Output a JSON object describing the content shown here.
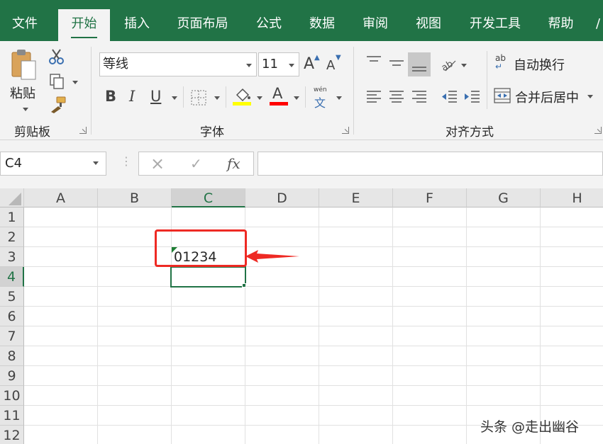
{
  "tabs": [
    "文件",
    "开始",
    "插入",
    "页面布局",
    "公式",
    "数据",
    "审阅",
    "视图",
    "开发工具",
    "帮助"
  ],
  "active_tab_index": 1,
  "clipboard": {
    "paste_label": "粘贴",
    "group_label": "剪贴板"
  },
  "font": {
    "font_name": "等线",
    "font_size": "11",
    "bold": "B",
    "italic": "I",
    "underline": "U",
    "grow_font": "A",
    "shrink_font": "A",
    "font_color_letter": "A",
    "phonetic_top": "wén",
    "phonetic_char": "文",
    "group_label": "字体",
    "highlight_color": "#ffff00",
    "font_color": "#ff0000"
  },
  "alignment": {
    "wrap_text_label": "自动换行",
    "wrap_icon_text": "ab",
    "merge_label": "合并后居中",
    "group_label": "对齐方式"
  },
  "formula_bar": {
    "name_box": "C4",
    "cancel_icon": "×",
    "enter_icon": "✓",
    "fx_label": "fx",
    "formula": ""
  },
  "sheet": {
    "columns": [
      "A",
      "B",
      "C",
      "D",
      "E",
      "F",
      "G",
      "H"
    ],
    "rows": [
      "1",
      "2",
      "3",
      "4",
      "5",
      "6",
      "7",
      "8",
      "9",
      "10",
      "11",
      "12"
    ],
    "selected_column": "C",
    "selected_row": "4",
    "cells": [
      {
        "ref": "C3",
        "value": "01234"
      }
    ]
  },
  "watermark": "头条 @走出幽谷",
  "colors": {
    "accent": "#217346",
    "annotation": "#ee2a24"
  }
}
